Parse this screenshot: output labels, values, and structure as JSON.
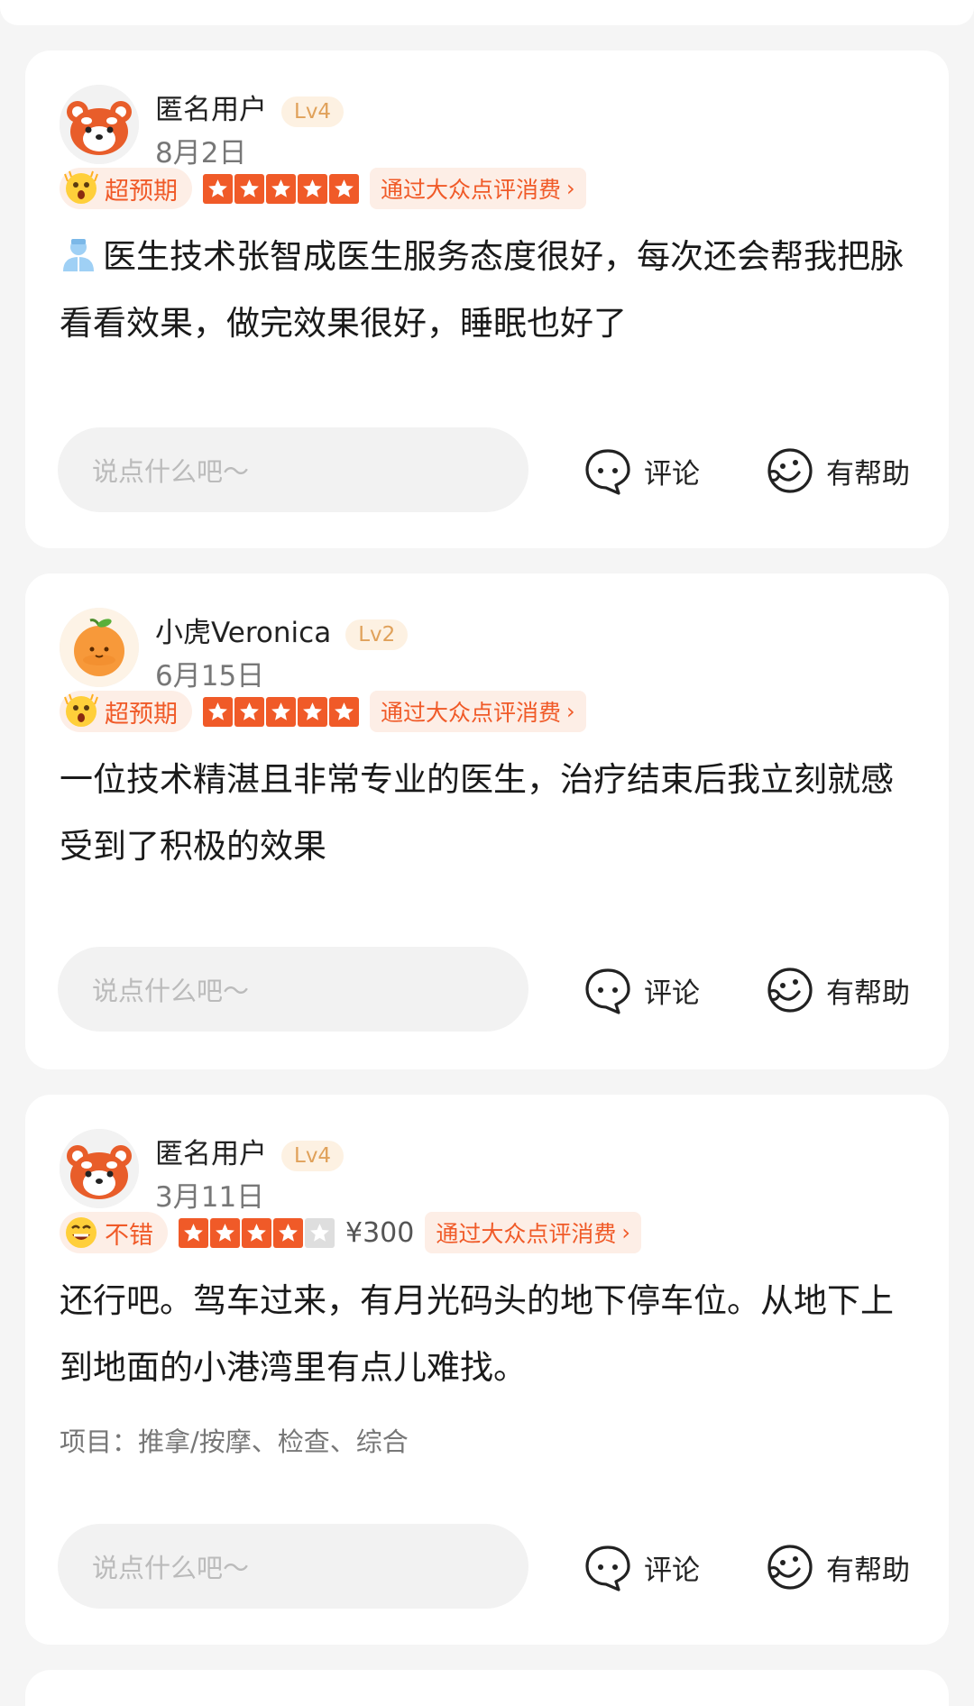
{
  "reviews": [
    {
      "username": "匿名用户",
      "level": "Lv4",
      "date": "8月2日",
      "avatar_icon": "red-panda-avatar",
      "mood_icon": "astonished-emoji-icon",
      "mood": "超预期",
      "rating": 5,
      "price": "",
      "source": "通过大众点评消费",
      "leading_icon": "doctor-emoji-icon",
      "text": "医生技术张智成医生服务态度很好，每次还会帮我把脉看看效果，做完效果很好，睡眠也好了",
      "project": "",
      "comment_placeholder": "说点什么吧～",
      "comment_label": "评论",
      "helpful_label": "有帮助"
    },
    {
      "username": "小虎Veronica",
      "level": "Lv2",
      "date": "6月15日",
      "avatar_icon": "orange-fruit-avatar",
      "mood_icon": "astonished-emoji-icon",
      "mood": "超预期",
      "rating": 5,
      "price": "",
      "source": "通过大众点评消费",
      "leading_icon": "",
      "text": "一位技术精湛且非常专业的医生，治疗结束后我立刻就感受到了积极的效果",
      "project": "",
      "comment_placeholder": "说点什么吧～",
      "comment_label": "评论",
      "helpful_label": "有帮助"
    },
    {
      "username": "匿名用户",
      "level": "Lv4",
      "date": "3月11日",
      "avatar_icon": "red-panda-avatar",
      "mood_icon": "grinning-emoji-icon",
      "mood": "不错",
      "rating": 4,
      "price": "¥300",
      "source": "通过大众点评消费",
      "leading_icon": "",
      "text": "还行吧。驾车过来，有月光码头的地下停车位。从地下上到地面的小港湾里有点儿难找。",
      "project": "项目：推拿/按摩、检查、综合",
      "comment_placeholder": "说点什么吧～",
      "comment_label": "评论",
      "helpful_label": "有帮助"
    }
  ],
  "colors": {
    "accent": "#f05a28",
    "accent_bg": "#fdeee6",
    "level_text": "#e0a15a",
    "page_bg": "#f5f5f5"
  }
}
